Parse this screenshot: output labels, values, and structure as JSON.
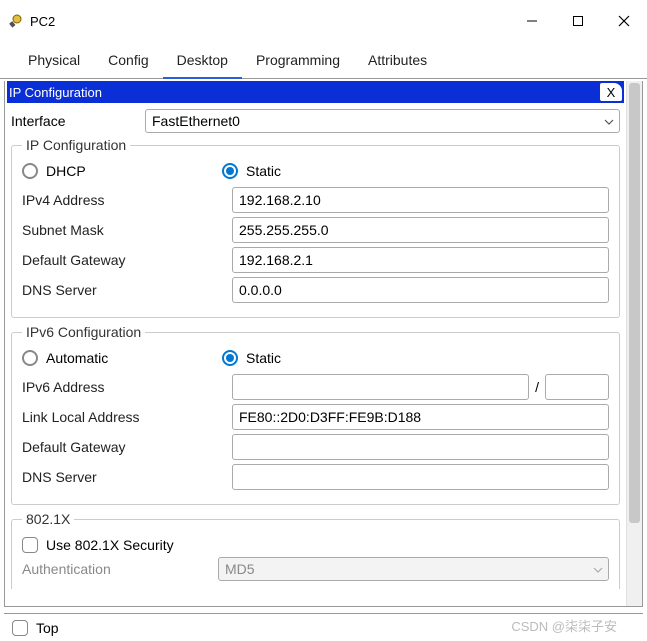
{
  "window": {
    "title": "PC2"
  },
  "tabs": {
    "items": [
      {
        "label": "Physical"
      },
      {
        "label": "Config"
      },
      {
        "label": "Desktop"
      },
      {
        "label": "Programming"
      },
      {
        "label": "Attributes"
      }
    ],
    "active_index": 2
  },
  "panel": {
    "title": "IP Configuration",
    "close_label": "X"
  },
  "interface": {
    "label": "Interface",
    "value": "FastEthernet0"
  },
  "ipconfig": {
    "legend": "IP Configuration",
    "radio_dhcp": "DHCP",
    "radio_static": "Static",
    "selected": "static",
    "ipv4_label": "IPv4 Address",
    "ipv4_value": "192.168.2.10",
    "subnet_label": "Subnet Mask",
    "subnet_value": "255.255.255.0",
    "gateway_label": "Default Gateway",
    "gateway_value": "192.168.2.1",
    "dns_label": "DNS Server",
    "dns_value": "0.0.0.0"
  },
  "ipv6": {
    "legend": "IPv6 Configuration",
    "radio_auto": "Automatic",
    "radio_static": "Static",
    "selected": "static",
    "addr_label": "IPv6 Address",
    "addr_value": "",
    "prefix_value": "",
    "linklocal_label": "Link Local Address",
    "linklocal_value": "FE80::2D0:D3FF:FE9B:D188",
    "gateway_label": "Default Gateway",
    "gateway_value": "",
    "dns_label": "DNS Server",
    "dns_value": ""
  },
  "dot1x": {
    "legend": "802.1X",
    "use_label": "Use 802.1X Security",
    "use_checked": false,
    "auth_label": "Authentication",
    "auth_value": "MD5"
  },
  "footer": {
    "top_label": "Top",
    "top_checked": false
  },
  "watermark": "CSDN @柒柒子安"
}
